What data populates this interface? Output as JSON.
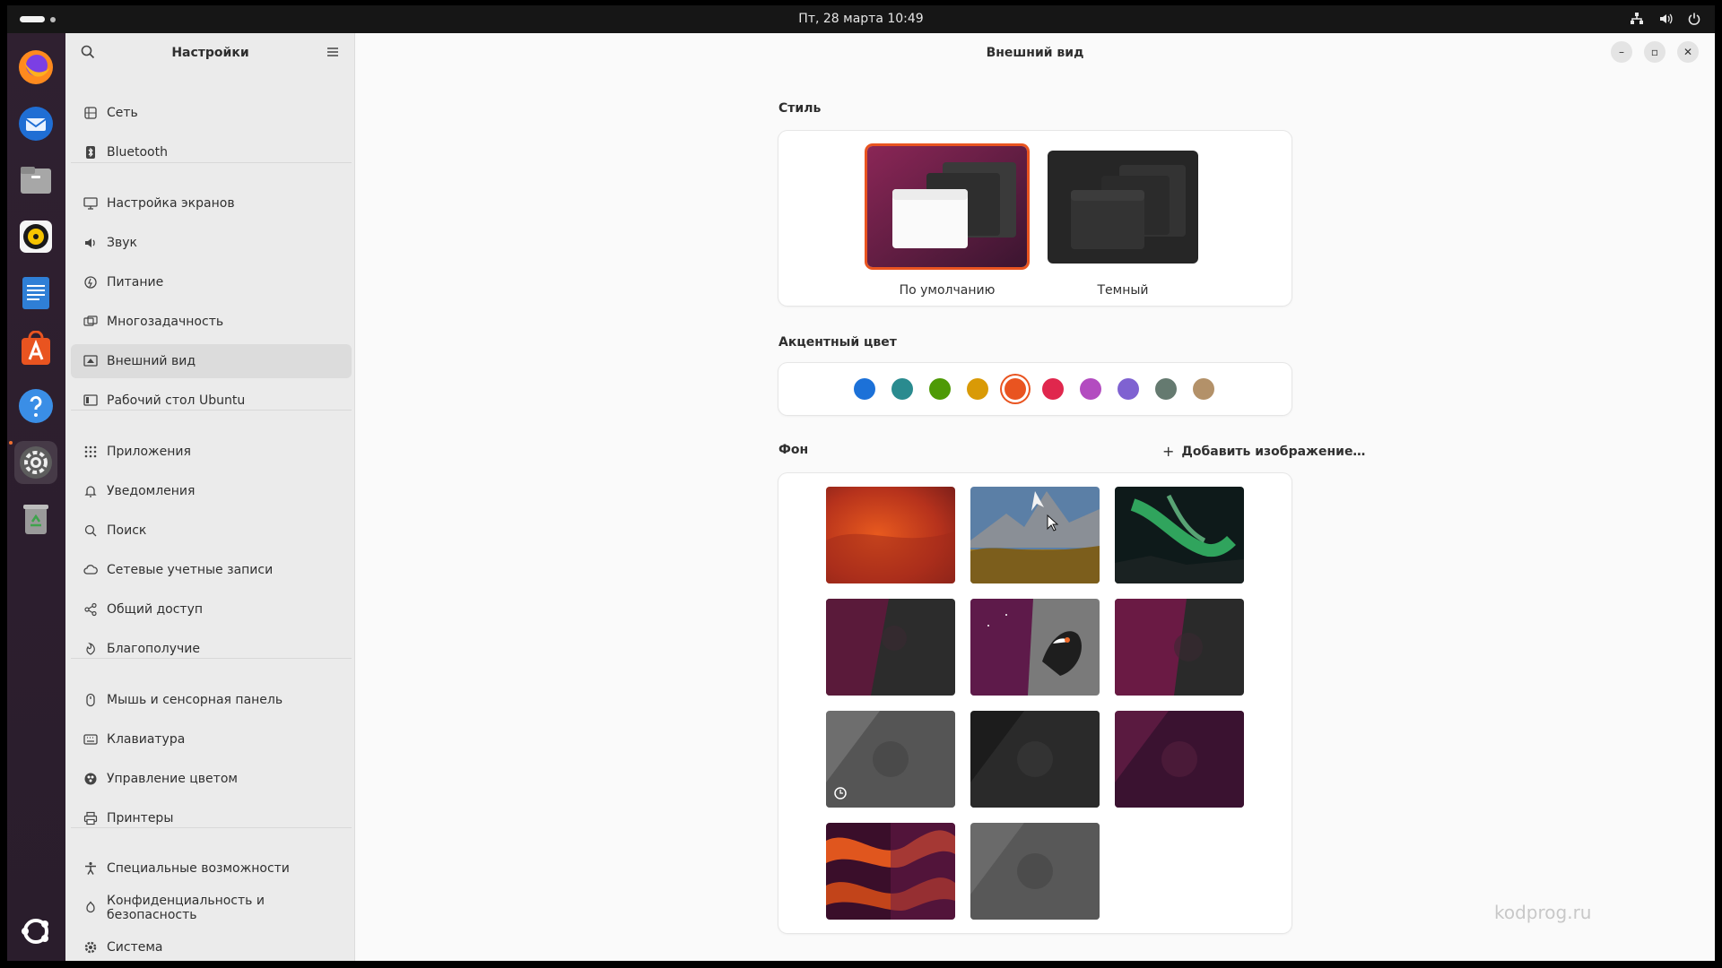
{
  "topbar": {
    "datetime": "Пт, 28 марта  10:49",
    "tray_icons": [
      "network-icon",
      "volume-icon",
      "power-icon"
    ]
  },
  "dock": {
    "apps": [
      {
        "name": "firefox-icon",
        "color": "#ff7a1a"
      },
      {
        "name": "thunderbird-icon",
        "color": "#2a7fd4"
      },
      {
        "name": "files-icon",
        "color": "#9a9a9a"
      },
      {
        "name": "rhythmbox-icon",
        "color": "#f6c400"
      },
      {
        "name": "libreoffice-writer-icon",
        "color": "#2a6fc9"
      },
      {
        "name": "app-center-icon",
        "color": "#e95420"
      },
      {
        "name": "help-icon",
        "color": "#3b8ee0"
      },
      {
        "name": "settings-icon",
        "color": "#7a7a7a"
      },
      {
        "name": "trash-icon",
        "color": "#8a8a8a"
      }
    ],
    "show_apps_icon": "ubuntu-show-apps-icon"
  },
  "sidebar": {
    "title": "Настройки",
    "items": [
      {
        "label": "Сеть",
        "icon": "network-icon"
      },
      {
        "label": "Bluetooth",
        "icon": "bluetooth-icon"
      },
      {
        "label": "Настройка экранов",
        "icon": "display-icon"
      },
      {
        "label": "Звук",
        "icon": "sound-icon"
      },
      {
        "label": "Питание",
        "icon": "power-icon"
      },
      {
        "label": "Многозадачность",
        "icon": "multitasking-icon"
      },
      {
        "label": "Внешний вид",
        "icon": "appearance-icon"
      },
      {
        "label": "Рабочий стол Ubuntu",
        "icon": "ubuntu-desktop-icon"
      },
      {
        "label": "Приложения",
        "icon": "apps-grid-icon"
      },
      {
        "label": "Уведомления",
        "icon": "bell-icon"
      },
      {
        "label": "Поиск",
        "icon": "search-icon"
      },
      {
        "label": "Сетевые учетные записи",
        "icon": "cloud-icon"
      },
      {
        "label": "Общий доступ",
        "icon": "share-icon"
      },
      {
        "label": "Благополучие",
        "icon": "wellbeing-icon"
      },
      {
        "label": "Мышь и сенсорная панель",
        "icon": "mouse-icon"
      },
      {
        "label": "Клавиатура",
        "icon": "keyboard-icon"
      },
      {
        "label": "Управление цветом",
        "icon": "color-icon"
      },
      {
        "label": "Принтеры",
        "icon": "printer-icon"
      },
      {
        "label": "Специальные возможности",
        "icon": "accessibility-icon"
      },
      {
        "label": "Конфиденциальность и безопасность",
        "icon": "privacy-icon"
      },
      {
        "label": "Система",
        "icon": "system-gear-icon"
      }
    ],
    "selected": "Внешний вид"
  },
  "content": {
    "title": "Внешний вид",
    "style": {
      "label": "Стиль",
      "options": [
        {
          "caption": "По умолчанию",
          "selected": true
        },
        {
          "caption": "Темный",
          "selected": false
        }
      ]
    },
    "accent": {
      "label": "Акцентный цвет",
      "colors": [
        "#1c71d8",
        "#2a8b8f",
        "#4e9a06",
        "#d99a06",
        "#e95420",
        "#e0274d",
        "#b34cc0",
        "#7f62d1",
        "#657a70",
        "#b39169"
      ],
      "selected": "#e95420"
    },
    "background": {
      "label": "Фон",
      "add_button": "Добавить изображение…"
    }
  },
  "watermark": "kodprog.ru"
}
